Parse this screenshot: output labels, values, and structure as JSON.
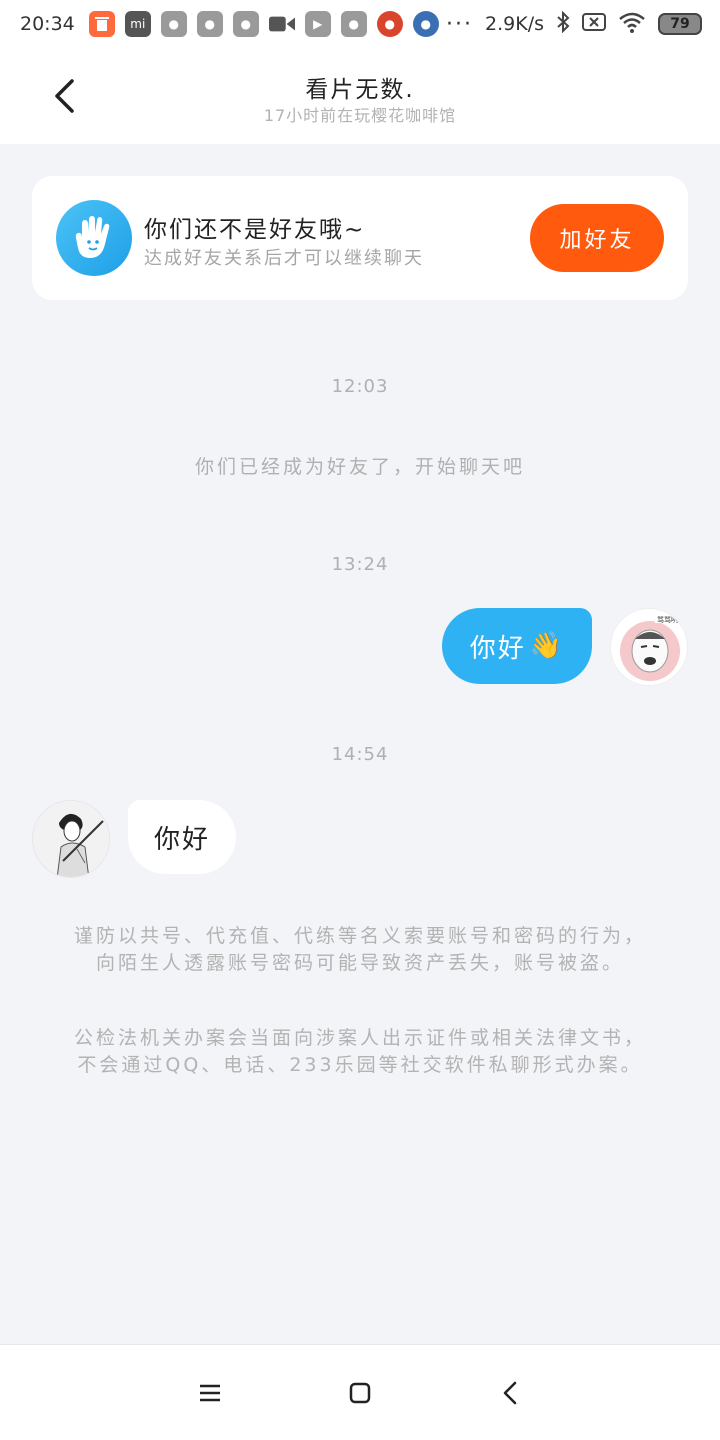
{
  "status_bar": {
    "time": "20:34",
    "speed": "2.9K/s",
    "battery": "79",
    "dots": "···",
    "icons": [
      "trash-app-icon",
      "mi-app-icon",
      "app-icon",
      "app-icon",
      "app-icon",
      "video-icon",
      "play-app-icon",
      "app-icon",
      "red-app-icon",
      "blue-app-icon",
      "bluetooth-icon",
      "sim-icon",
      "wifi-icon",
      "battery-icon"
    ]
  },
  "header": {
    "title": "看片无数.",
    "subtitle": "17小时前在玩樱花咖啡馆"
  },
  "friend_card": {
    "title": "你们还不是好友哦~",
    "subtitle": "达成好友关系后才可以继续聊天",
    "button": "加好友"
  },
  "chat": {
    "time1": "12:03",
    "system_msg": "你们已经成为好友了，开始聊天吧",
    "time2": "13:24",
    "my_message": "你好",
    "my_emoji": "👋",
    "time3": "14:54",
    "their_message": "你好"
  },
  "notices": {
    "notice1": "谨防以共号、代充值、代练等名义索要账号和密码的行为，向陌生人透露账号密码可能导致资产丢失，账号被盗。",
    "notice2": "公检法机关办案会当面向涉案人出示证件或相关法律文书，不会通过QQ、电话、233乐园等社交软件私聊形式办案。"
  },
  "colors": {
    "accent_orange": "#ff5a0e",
    "bubble_blue": "#2eb2f3",
    "background": "#f3f4f8"
  }
}
